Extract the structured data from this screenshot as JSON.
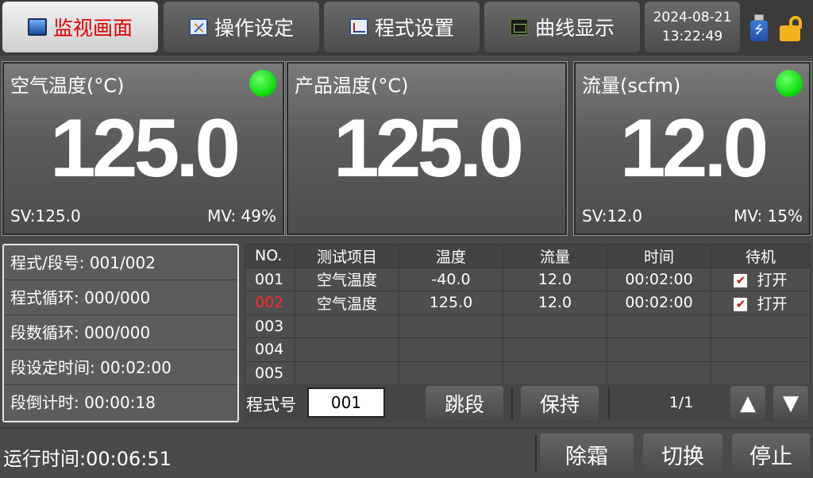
{
  "tabs": [
    {
      "label": "监视画面",
      "icon": "monitor-icon",
      "active": true
    },
    {
      "label": "操作设定",
      "icon": "tools-icon",
      "active": false
    },
    {
      "label": "程式设置",
      "icon": "graph-icon",
      "active": false
    },
    {
      "label": "曲线显示",
      "icon": "curve-icon",
      "active": false
    }
  ],
  "datetime": {
    "date": "2024-08-21",
    "time": "13:22:49"
  },
  "status_icons": {
    "usb": "usb-icon",
    "lock": "unlocked-icon"
  },
  "panels": [
    {
      "title": "空气温度(°C)",
      "value": "125.0",
      "sv": "SV:125.0",
      "mv": "MV: 49%",
      "led_color": "#12e012"
    },
    {
      "title": "产品温度(°C)",
      "value": "125.0"
    },
    {
      "title": "流量(scfm)",
      "value": "12.0",
      "sv": "SV:12.0",
      "mv": "MV: 15%",
      "led_color": "#12e012"
    }
  ],
  "info": {
    "program_segment": "程式/段号: 001/002",
    "program_cycle": "程式循环: 000/000",
    "segment_cycle": "段数循环: 000/000",
    "segment_set_time": "段设定时间: 00:02:00",
    "segment_countdown": "段倒计时: 00:00:18"
  },
  "table": {
    "headers": [
      "NO.",
      "测试项目",
      "温度",
      "流量",
      "时间",
      "待机"
    ],
    "rows": [
      {
        "no": "001",
        "item": "空气温度",
        "temp": "-40.0",
        "flow": "12.0",
        "time": "00:02:00",
        "standby": "打开",
        "checked": true,
        "current": false
      },
      {
        "no": "002",
        "item": "空气温度",
        "temp": "125.0",
        "flow": "12.0",
        "time": "00:02:00",
        "standby": "打开",
        "checked": true,
        "current": true
      },
      {
        "no": "003"
      },
      {
        "no": "004"
      },
      {
        "no": "005"
      }
    ]
  },
  "program": {
    "label": "程式号",
    "value": "001",
    "jump_label": "跳段",
    "hold_label": "保持",
    "page": "1/1"
  },
  "status": {
    "runtime": "运行时间:00:06:51",
    "defrost_label": "除霜",
    "switch_label": "切换",
    "stop_label": "停止"
  },
  "colors": {
    "accent_red": "#ff2a2a",
    "led_green": "#12e012",
    "lock_yellow": "#f2b21c"
  }
}
